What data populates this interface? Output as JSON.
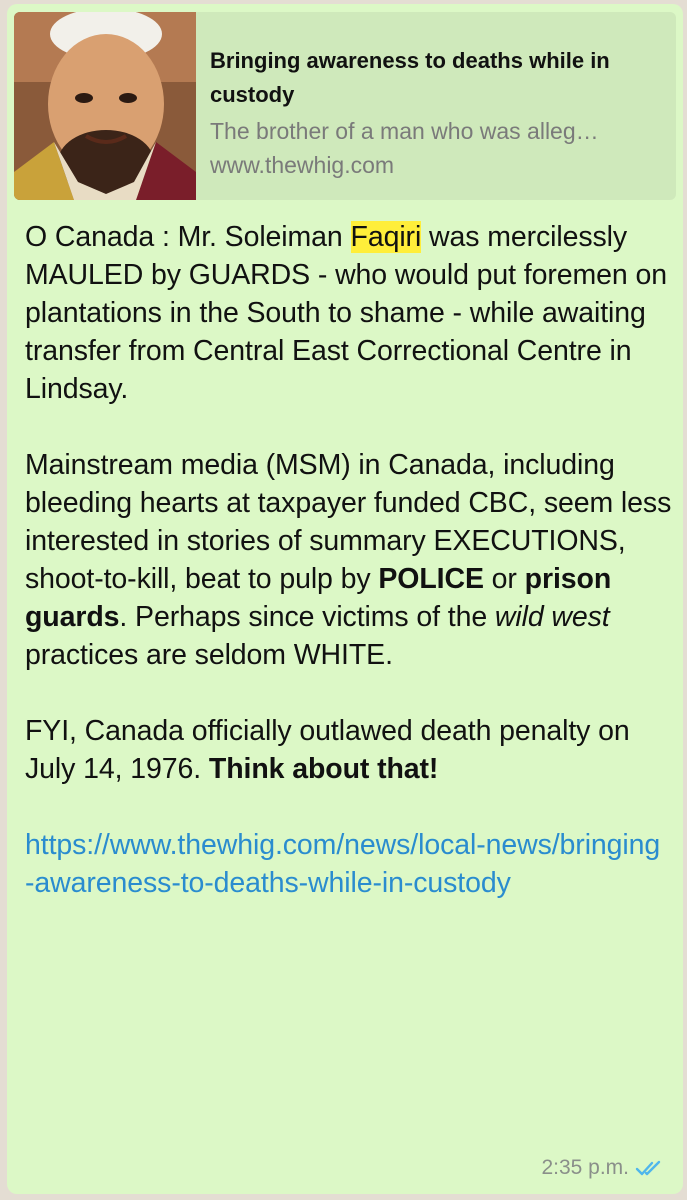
{
  "preview": {
    "title": "Bringing awareness to deaths while in custody",
    "description": "The brother of a man who was alleg…",
    "domain": "www.thewhig.com",
    "thumbnail_icon": "person-photo"
  },
  "message": {
    "p1_before": "O Canada : Mr. Soleiman ",
    "p1_highlight": "Faqiri",
    "p1_after": " was mercilessly MAULED by GUARDS - who would put foremen on plantations in the South to shame - while awaiting transfer from Central East Correctional Centre in Lindsay.",
    "p2_part1": "Mainstream media (MSM) in Canada, including bleeding hearts at taxpayer funded CBC, seem less interested in stories of summary EXECUTIONS, shoot-to-kill, beat to pulp by ",
    "p2_bold1": "POLICE",
    "p2_part2": " or ",
    "p2_bold2": "prison guards",
    "p2_part3": ". Perhaps since victims of the ",
    "p2_italic": "wild west",
    "p2_part4": " practices are seldom WHITE.",
    "p3_part1": "FYI, Canada officially outlawed death penalty on July 14, 1976. ",
    "p3_bold": "Think about that!",
    "link": "https://www.thewhig.com/news/local-news/bringing-awareness-to-deaths-while-in-custody"
  },
  "meta": {
    "time": "2:35 p.m.",
    "status_icon": "double-check-read-icon",
    "tick_color": "#4fb6ec"
  },
  "colors": {
    "bubble": "#dcf8c6",
    "preview_bg": "#cfe9bb",
    "highlight": "#ffee3a",
    "link": "#2a8ccf"
  }
}
